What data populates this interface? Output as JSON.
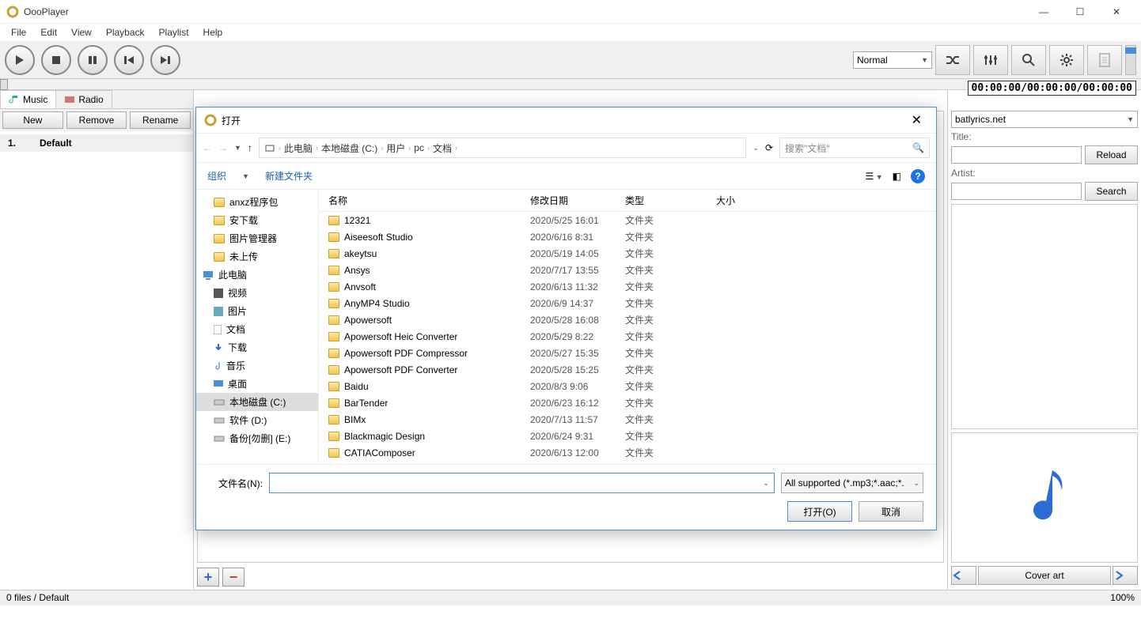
{
  "app": {
    "title": "OooPlayer"
  },
  "menu": [
    "File",
    "Edit",
    "View",
    "Playback",
    "Playlist",
    "Help"
  ],
  "playmode": "Normal",
  "time": "00:00:00/00:00:00/00:00:00",
  "tabs": {
    "music": "Music",
    "radio": "Radio"
  },
  "plbtns": {
    "new": "New",
    "remove": "Remove",
    "rename": "Rename"
  },
  "playlist": [
    {
      "n": "1.",
      "name": "Default"
    }
  ],
  "lyrics": {
    "source": "batlyrics.net",
    "title_lbl": "Title:",
    "artist_lbl": "Artist:",
    "reload": "Reload",
    "search": "Search"
  },
  "cover": {
    "label": "Cover art"
  },
  "status": {
    "left": "0 files / Default",
    "right": "100%"
  },
  "dialog": {
    "title": "打开",
    "crumbs": [
      "此电脑",
      "本地磁盘 (C:)",
      "用户",
      "pc",
      "文档"
    ],
    "search_ph": "搜索\"文档\"",
    "organize": "组织",
    "newfolder": "新建文件夹",
    "side": [
      {
        "icon": "folder",
        "label": "anxz程序包"
      },
      {
        "icon": "folder",
        "label": "安下载"
      },
      {
        "icon": "folder",
        "label": "图片管理器"
      },
      {
        "icon": "folder",
        "label": "未上传"
      },
      {
        "icon": "pc",
        "label": "此电脑",
        "top": true
      },
      {
        "icon": "video",
        "label": "视频"
      },
      {
        "icon": "image",
        "label": "图片"
      },
      {
        "icon": "doc",
        "label": "文档"
      },
      {
        "icon": "down",
        "label": "下载"
      },
      {
        "icon": "music",
        "label": "音乐"
      },
      {
        "icon": "desk",
        "label": "桌面"
      },
      {
        "icon": "disk",
        "label": "本地磁盘 (C:)",
        "sel": true
      },
      {
        "icon": "disk",
        "label": "软件 (D:)"
      },
      {
        "icon": "disk",
        "label": "备份[勿删] (E:)"
      }
    ],
    "cols": {
      "name": "名称",
      "date": "修改日期",
      "type": "类型",
      "size": "大小"
    },
    "rows": [
      {
        "n": "12321",
        "d": "2020/5/25 16:01",
        "t": "文件夹"
      },
      {
        "n": "Aiseesoft Studio",
        "d": "2020/6/16 8:31",
        "t": "文件夹"
      },
      {
        "n": "akeytsu",
        "d": "2020/5/19 14:05",
        "t": "文件夹"
      },
      {
        "n": "Ansys",
        "d": "2020/7/17 13:55",
        "t": "文件夹"
      },
      {
        "n": "Anvsoft",
        "d": "2020/6/13 11:32",
        "t": "文件夹"
      },
      {
        "n": "AnyMP4 Studio",
        "d": "2020/6/9 14:37",
        "t": "文件夹"
      },
      {
        "n": "Apowersoft",
        "d": "2020/5/28 16:08",
        "t": "文件夹"
      },
      {
        "n": "Apowersoft Heic Converter",
        "d": "2020/5/29 8:22",
        "t": "文件夹"
      },
      {
        "n": "Apowersoft PDF Compressor",
        "d": "2020/5/27 15:35",
        "t": "文件夹"
      },
      {
        "n": "Apowersoft PDF Converter",
        "d": "2020/5/28 15:25",
        "t": "文件夹"
      },
      {
        "n": "Baidu",
        "d": "2020/8/3 9:06",
        "t": "文件夹"
      },
      {
        "n": "BarTender",
        "d": "2020/6/23 16:12",
        "t": "文件夹"
      },
      {
        "n": "BIMx",
        "d": "2020/7/13 11:57",
        "t": "文件夹"
      },
      {
        "n": "Blackmagic Design",
        "d": "2020/6/24 9:31",
        "t": "文件夹"
      },
      {
        "n": "CATIAComposer",
        "d": "2020/6/13 12:00",
        "t": "文件夹"
      }
    ],
    "filename_lbl": "文件名(N):",
    "filter": "All supported (*.mp3;*.aac;*.",
    "open": "打开(O)",
    "cancel": "取消"
  }
}
